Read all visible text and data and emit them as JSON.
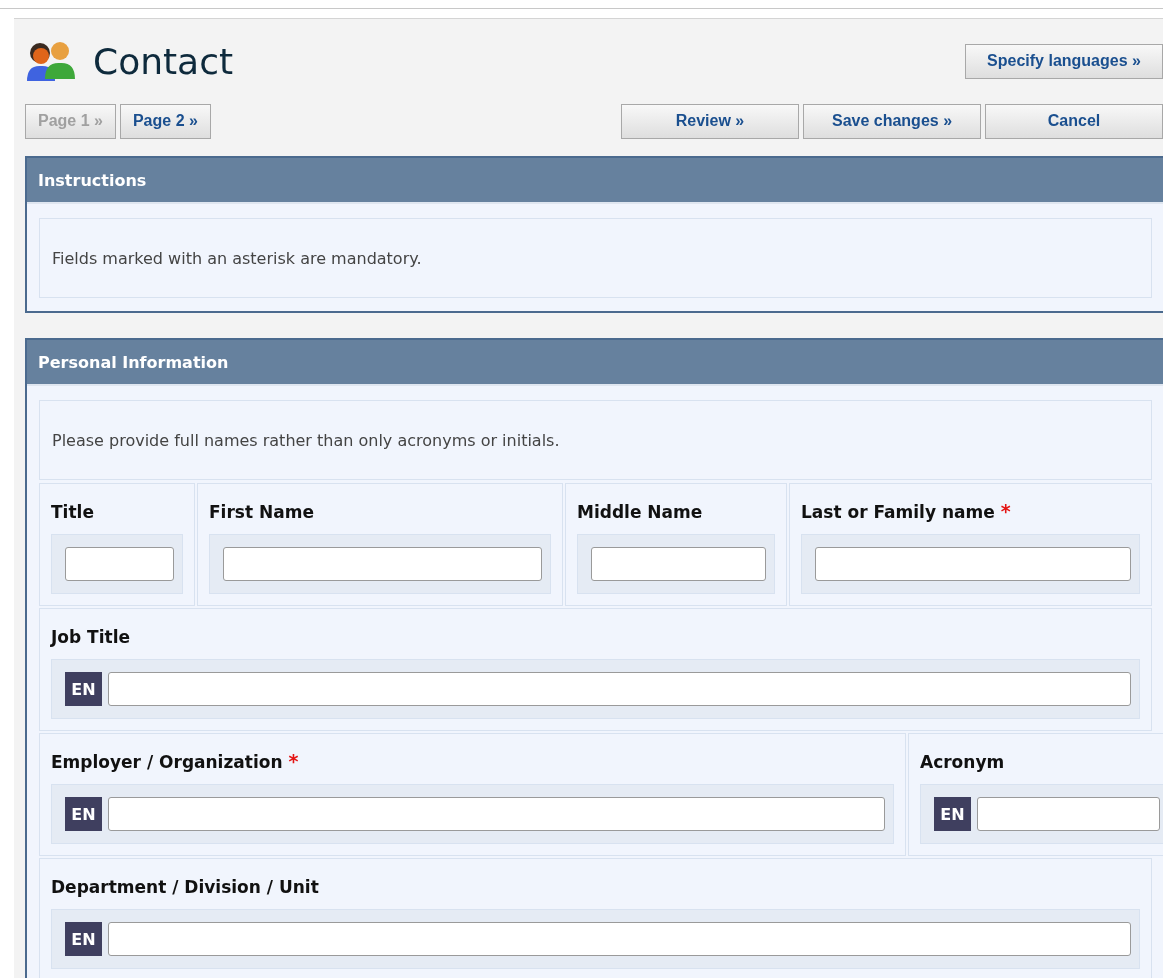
{
  "header": {
    "title": "Contact",
    "languages_button": "Specify languages »"
  },
  "pager": [
    {
      "label": "Page 1 »",
      "disabled": true
    },
    {
      "label": "Page 2 »",
      "disabled": false
    }
  ],
  "actions": [
    "Review »",
    "Save changes »",
    "Cancel"
  ],
  "instructions": {
    "heading": "Instructions",
    "text": "Fields marked with an asterisk are mandatory."
  },
  "personal": {
    "heading": "Personal Information",
    "note": "Please provide full names rather than only acronyms or initials.",
    "rows": [
      {
        "fields": [
          {
            "label": "Title"
          },
          {
            "label": "First Name"
          },
          {
            "label": "Middle Name"
          },
          {
            "label": "Last or Family name",
            "required_mark": "*"
          }
        ]
      },
      {
        "fields": [
          {
            "label": "Job Title",
            "language": "EN"
          }
        ]
      },
      {
        "fields": [
          {
            "label": "Employer / Organization",
            "required_mark": "*",
            "language": "EN"
          },
          {
            "label": "Acronym",
            "language": "EN"
          }
        ]
      },
      {
        "fields": [
          {
            "label": "Department / Division / Unit",
            "language": "EN"
          }
        ]
      }
    ]
  }
}
